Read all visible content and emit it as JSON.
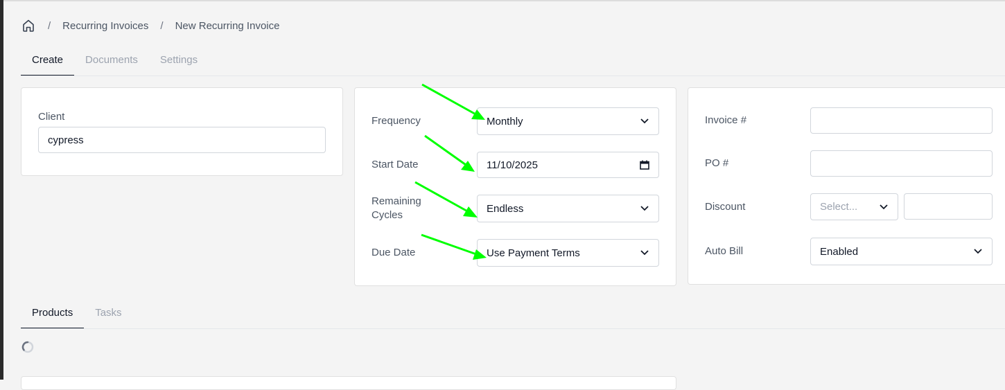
{
  "breadcrumb": {
    "home_icon": "home-icon",
    "separator": "/",
    "items": [
      "Recurring Invoices",
      "New Recurring Invoice"
    ]
  },
  "top_tabs": [
    "Create",
    "Documents",
    "Settings"
  ],
  "client_card": {
    "label": "Client",
    "value": "cypress"
  },
  "schedule_card": {
    "frequency_label": "Frequency",
    "frequency_value": "Monthly",
    "start_date_label": "Start Date",
    "start_date_value": "11/10/2025",
    "remaining_cycles_label": "Remaining Cycles",
    "remaining_cycles_value": "Endless",
    "due_date_label": "Due Date",
    "due_date_value": "Use Payment Terms"
  },
  "details_card": {
    "invoice_number_label": "Invoice #",
    "invoice_number_value": "",
    "po_number_label": "PO #",
    "po_number_value": "",
    "discount_label": "Discount",
    "discount_type_placeholder": "Select...",
    "discount_value": "",
    "auto_bill_label": "Auto Bill",
    "auto_bill_value": "Enabled"
  },
  "bottom_tabs": [
    "Products",
    "Tasks"
  ],
  "colors": {
    "annotation_arrow": "#00ff00",
    "active_tab": "#111827",
    "inactive_tab": "#9ca3af",
    "background": "#f4f4f4"
  }
}
